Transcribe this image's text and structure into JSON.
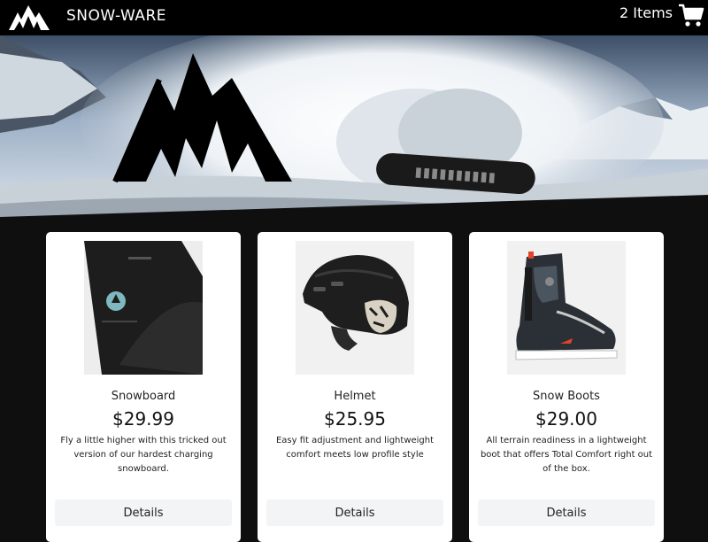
{
  "header": {
    "brand": "SNOW-WARE",
    "cart_count_label": "2 Items",
    "logo_icon": "mountain-logo-icon",
    "cart_icon": "shopping-cart-icon"
  },
  "hero": {
    "logo_icon": "mountain-logo-icon",
    "scene": "snowboarder-spray-photo"
  },
  "products": [
    {
      "name": "Snowboard",
      "price": "$29.99",
      "description": "Fly a little higher with this tricked out version of our hardest charging snowboard.",
      "details_label": "Details",
      "image": "snowboard-image"
    },
    {
      "name": "Helmet",
      "price": "$25.95",
      "description": "Easy fit adjustment and lightweight comfort meets low profile style",
      "details_label": "Details",
      "image": "helmet-image"
    },
    {
      "name": "Snow Boots",
      "price": "$29.00",
      "description": "All terrain readiness in a lightweight boot that offers Total Comfort right out of the box.",
      "details_label": "Details",
      "image": "snow-boots-image"
    }
  ],
  "colors": {
    "header_bg": "#000000",
    "page_bg": "#0f0f0f",
    "card_bg": "#ffffff",
    "button_bg": "#f3f4f6"
  }
}
